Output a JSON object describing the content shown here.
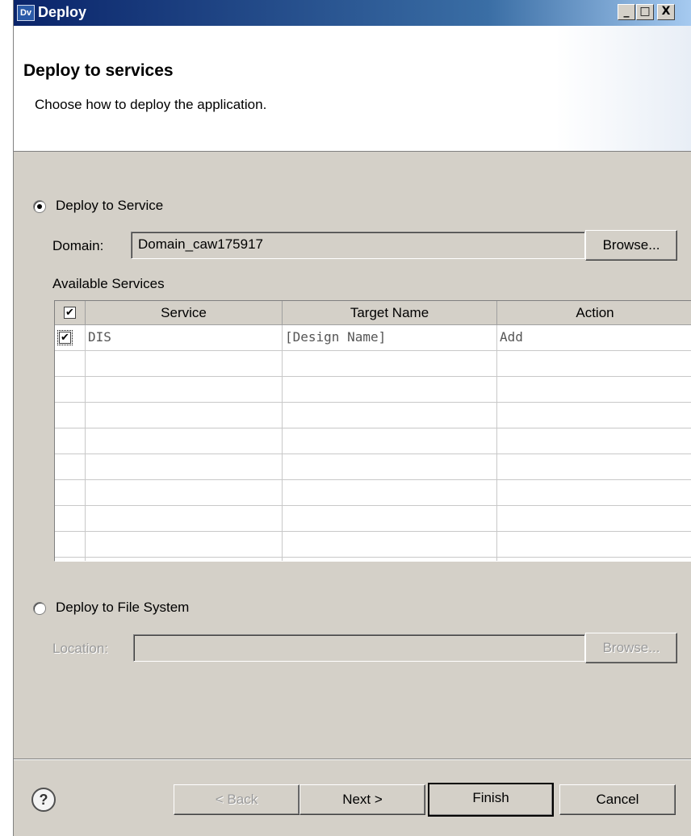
{
  "window": {
    "title": "Deploy",
    "icon_text": "Dv",
    "minimize": "_",
    "maximize": "□",
    "close": "X"
  },
  "header": {
    "title": "Deploy to services",
    "subtitle": "Choose how to deploy the application."
  },
  "service_option": {
    "label": "Deploy to Service",
    "selected": true,
    "domain_label": "Domain:",
    "domain_value": "Domain_caw175917",
    "browse_label": "Browse...",
    "available_label": "Available Services"
  },
  "table": {
    "header_checkbox": "✔",
    "columns": [
      "Service",
      "Target Name",
      "Action"
    ],
    "rows": [
      {
        "checked": "✔",
        "service": "DIS",
        "target": "[Design Name]",
        "action": "Add"
      }
    ]
  },
  "file_option": {
    "label": "Deploy to File System",
    "selected": false,
    "location_label": "Location:",
    "location_value": "",
    "browse_label": "Browse..."
  },
  "footer": {
    "help": "?",
    "back": "< Back",
    "next": "Next >",
    "finish": "Finish",
    "cancel": "Cancel"
  }
}
